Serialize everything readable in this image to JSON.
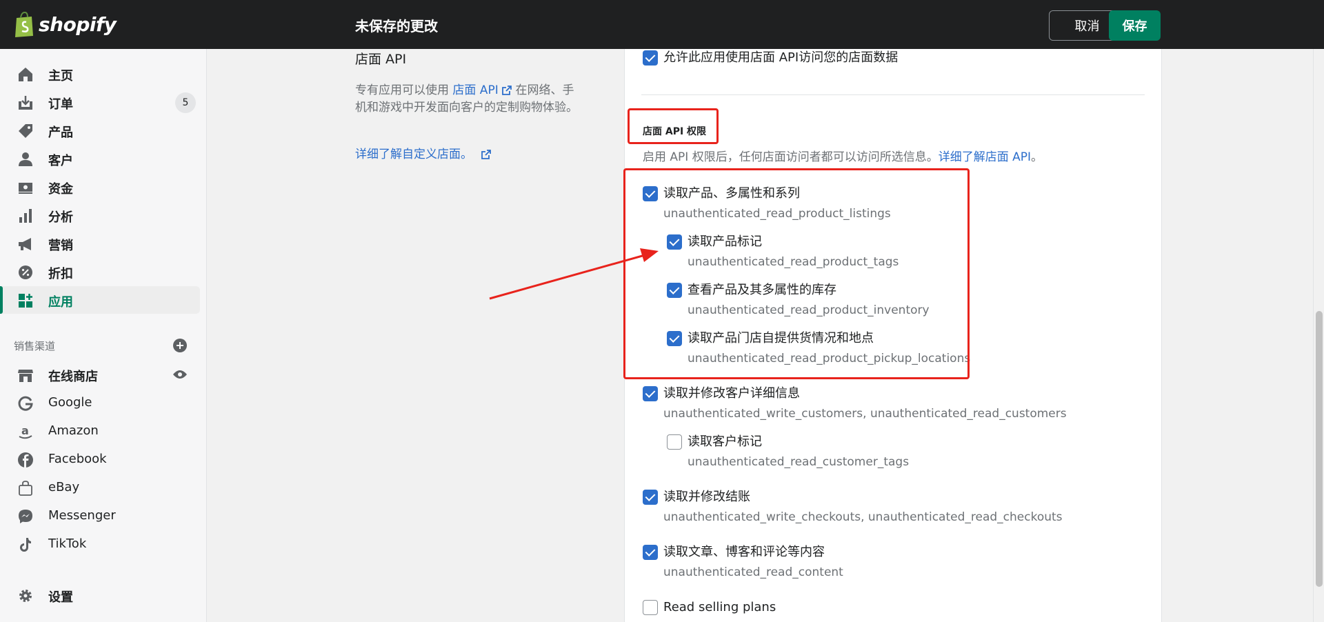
{
  "topbar": {
    "logo_text": "shopify",
    "title": "未保存的更改",
    "cancel_label": "取消",
    "save_label": "保存"
  },
  "sidebar": {
    "items": [
      {
        "label": "主页",
        "icon": "home-icon"
      },
      {
        "label": "订单",
        "icon": "orders-icon",
        "badge": "5"
      },
      {
        "label": "产品",
        "icon": "tag-icon"
      },
      {
        "label": "客户",
        "icon": "person-icon"
      },
      {
        "label": "资金",
        "icon": "finance-icon"
      },
      {
        "label": "分析",
        "icon": "bar-chart-icon"
      },
      {
        "label": "营销",
        "icon": "megaphone-icon"
      },
      {
        "label": "折扣",
        "icon": "discount-icon"
      },
      {
        "label": "应用",
        "icon": "apps-icon",
        "active": true
      }
    ],
    "channels_label": "销售渠道",
    "channels": [
      {
        "label": "在线商店",
        "icon": "store-icon"
      },
      {
        "label": "Google",
        "icon": "google-icon"
      },
      {
        "label": "Amazon",
        "icon": "amazon-icon"
      },
      {
        "label": "Facebook",
        "icon": "facebook-icon"
      },
      {
        "label": "eBay",
        "icon": "ebay-bag-icon"
      },
      {
        "label": "Messenger",
        "icon": "messenger-icon"
      },
      {
        "label": "TikTok",
        "icon": "tiktok-icon"
      }
    ],
    "settings_label": "设置"
  },
  "main": {
    "section_title": "店面 API",
    "desc_prefix": "专有应用可以使用",
    "desc_link": "店面 API",
    "desc_suffix": "在网络、手机和游戏中开发面向客户的定制购物体验。",
    "learn_more": "详细了解自定义店面。",
    "allow_access": "允许此应用使用店面 API访问您的店面数据",
    "perm_heading": "店面 API 权限",
    "perm_desc": "启用 API 权限后，任何店面访问者都可以访问所选信息。",
    "perm_desc_link": "详细了解店面 API",
    "perm_desc_end": "。",
    "permissions": [
      {
        "label": "读取产品、多属性和系列",
        "scope": "unauthenticated_read_product_listings",
        "checked": true
      },
      {
        "label": "读取产品标记",
        "scope": "unauthenticated_read_product_tags",
        "checked": true
      },
      {
        "label": "查看产品及其多属性的库存",
        "scope": "unauthenticated_read_product_inventory",
        "checked": true
      },
      {
        "label": "读取产品门店自提供货情况和地点",
        "scope": "unauthenticated_read_product_pickup_locations",
        "checked": true
      },
      {
        "label": "读取并修改客户详细信息",
        "scope": "unauthenticated_write_customers, unauthenticated_read_customers",
        "checked": true
      },
      {
        "label": "读取客户标记",
        "scope": "unauthenticated_read_customer_tags",
        "checked": false
      },
      {
        "label": "读取并修改结账",
        "scope": "unauthenticated_write_checkouts, unauthenticated_read_checkouts",
        "checked": true
      },
      {
        "label": "读取文章、博客和评论等内容",
        "scope": "unauthenticated_read_content",
        "checked": true
      },
      {
        "label": "Read selling plans",
        "scope": "",
        "checked": false
      }
    ]
  },
  "colors": {
    "accent": "#008060",
    "checkbox": "#2c6ecb",
    "annotation": "#e8231c"
  }
}
